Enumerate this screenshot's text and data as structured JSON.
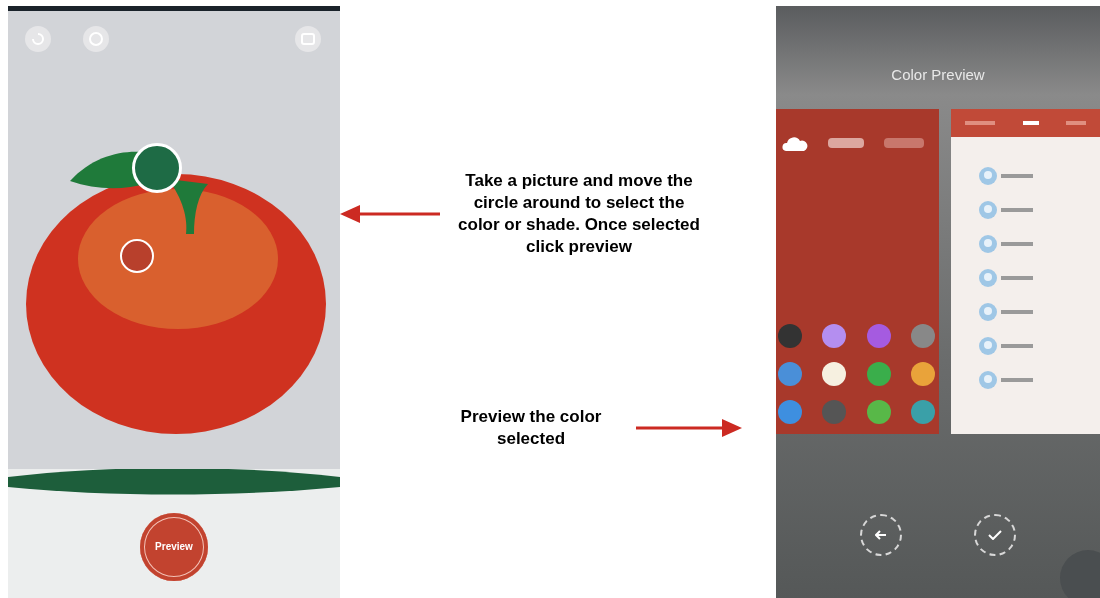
{
  "left_screen": {
    "pickers": [
      {
        "color": "#1e6b45",
        "kind": "large"
      },
      {
        "color": "#b8402c",
        "kind": "small"
      }
    ],
    "preview_button": "Preview"
  },
  "annotations": [
    {
      "text": "Take a picture and move the circle around to select the color or shade. Once selected click preview",
      "kind": "left"
    },
    {
      "text": "Preview the color selected",
      "kind": "right"
    }
  ],
  "right_screen": {
    "title": "Color Preview"
  }
}
